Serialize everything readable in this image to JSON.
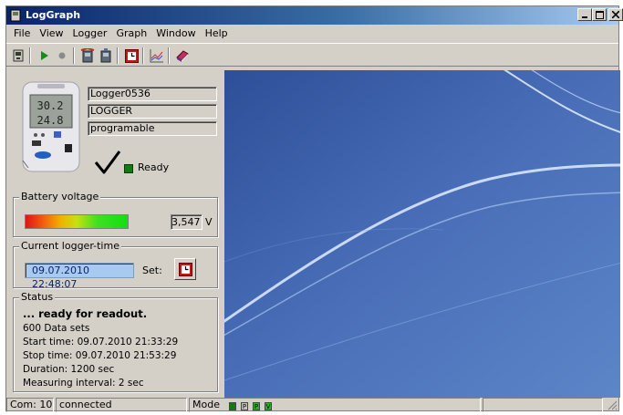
{
  "window": {
    "title": "LogGraph"
  },
  "menu": [
    "File",
    "View",
    "Logger",
    "Graph",
    "Window",
    "Help"
  ],
  "toolbar": {
    "icons": [
      "logger-read-icon",
      "play-icon",
      "record-icon",
      "download-icon",
      "upload-icon",
      "clock-icon",
      "graph-icon",
      "book-icon"
    ]
  },
  "device": {
    "name": "Logger0536",
    "type": "LOGGER",
    "mode": "programable",
    "status": "Ready",
    "lcd_top": "30.2",
    "lcd_bottom": "24.8"
  },
  "battery": {
    "legend": "Battery voltage",
    "value": "3,547",
    "unit": "V",
    "level_percent": 52
  },
  "logger_time": {
    "legend": "Current logger-time",
    "value": "09.07.2010 22:48:07",
    "set_label": "Set:"
  },
  "status": {
    "legend": "Status",
    "headline": "... ready for readout.",
    "lines": [
      "600 Data sets",
      "Start time: 09.07.2010 21:33:29",
      "Stop time: 09.07.2010 21:53:29",
      "Duration: 1200 sec",
      "Measuring interval: 2 sec"
    ]
  },
  "statusbar": {
    "port": "Com: 10",
    "connection": "connected",
    "mode_label": "Mode",
    "mode_leds": [
      "",
      "P",
      "P",
      "V"
    ]
  },
  "colors": {
    "ready": "#117a11",
    "graph_bg": "#3d5a9f",
    "titlebar": "#0a246a"
  }
}
